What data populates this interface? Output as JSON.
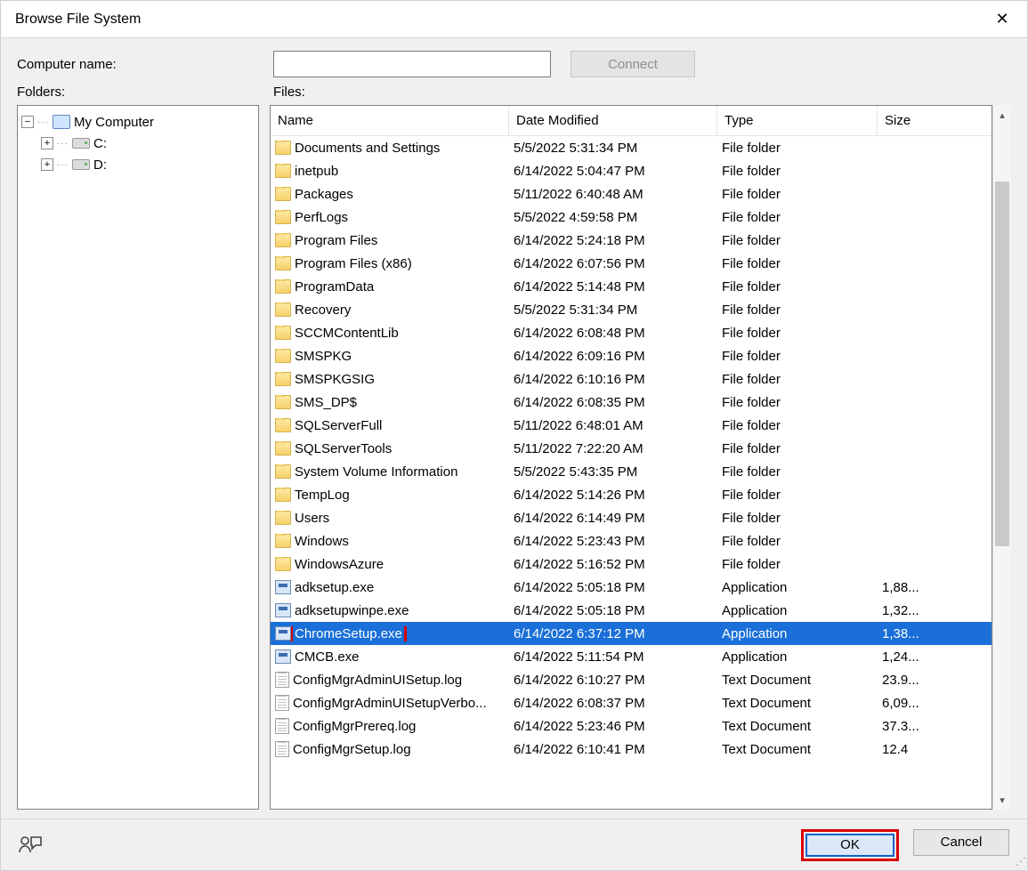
{
  "window": {
    "title": "Browse File System"
  },
  "labels": {
    "computer_name": "Computer name:",
    "folders": "Folders:",
    "files": "Files:"
  },
  "buttons": {
    "connect": "Connect",
    "ok": "OK",
    "cancel": "Cancel"
  },
  "inputs": {
    "computer_name_value": ""
  },
  "tree": {
    "root": "My Computer",
    "drives": [
      "C:",
      "D:"
    ]
  },
  "columns": {
    "name": "Name",
    "date": "Date Modified",
    "type": "Type",
    "size": "Size"
  },
  "types": {
    "folder": "File folder",
    "app": "Application",
    "txt": "Text Document"
  },
  "files": [
    {
      "icon": "folder",
      "name": "Documents and Settings",
      "date": "5/5/2022 5:31:34 PM",
      "type": "folder",
      "size": ""
    },
    {
      "icon": "folder",
      "name": "inetpub",
      "date": "6/14/2022 5:04:47 PM",
      "type": "folder",
      "size": ""
    },
    {
      "icon": "folder",
      "name": "Packages",
      "date": "5/11/2022 6:40:48 AM",
      "type": "folder",
      "size": ""
    },
    {
      "icon": "folder",
      "name": "PerfLogs",
      "date": "5/5/2022 4:59:58 PM",
      "type": "folder",
      "size": ""
    },
    {
      "icon": "folder",
      "name": "Program Files",
      "date": "6/14/2022 5:24:18 PM",
      "type": "folder",
      "size": ""
    },
    {
      "icon": "folder",
      "name": "Program Files (x86)",
      "date": "6/14/2022 6:07:56 PM",
      "type": "folder",
      "size": ""
    },
    {
      "icon": "folder",
      "name": "ProgramData",
      "date": "6/14/2022 5:14:48 PM",
      "type": "folder",
      "size": ""
    },
    {
      "icon": "folder",
      "name": "Recovery",
      "date": "5/5/2022 5:31:34 PM",
      "type": "folder",
      "size": ""
    },
    {
      "icon": "folder",
      "name": "SCCMContentLib",
      "date": "6/14/2022 6:08:48 PM",
      "type": "folder",
      "size": ""
    },
    {
      "icon": "folder",
      "name": "SMSPKG",
      "date": "6/14/2022 6:09:16 PM",
      "type": "folder",
      "size": ""
    },
    {
      "icon": "folder",
      "name": "SMSPKGSIG",
      "date": "6/14/2022 6:10:16 PM",
      "type": "folder",
      "size": ""
    },
    {
      "icon": "folder",
      "name": "SMS_DP$",
      "date": "6/14/2022 6:08:35 PM",
      "type": "folder",
      "size": ""
    },
    {
      "icon": "folder",
      "name": "SQLServerFull",
      "date": "5/11/2022 6:48:01 AM",
      "type": "folder",
      "size": ""
    },
    {
      "icon": "folder",
      "name": "SQLServerTools",
      "date": "5/11/2022 7:22:20 AM",
      "type": "folder",
      "size": ""
    },
    {
      "icon": "folder",
      "name": "System Volume Information",
      "date": "5/5/2022 5:43:35 PM",
      "type": "folder",
      "size": ""
    },
    {
      "icon": "folder",
      "name": "TempLog",
      "date": "6/14/2022 5:14:26 PM",
      "type": "folder",
      "size": ""
    },
    {
      "icon": "folder",
      "name": "Users",
      "date": "6/14/2022 6:14:49 PM",
      "type": "folder",
      "size": ""
    },
    {
      "icon": "folder",
      "name": "Windows",
      "date": "6/14/2022 5:23:43 PM",
      "type": "folder",
      "size": ""
    },
    {
      "icon": "folder",
      "name": "WindowsAzure",
      "date": "6/14/2022 5:16:52 PM",
      "type": "folder",
      "size": ""
    },
    {
      "icon": "exe",
      "name": "adksetup.exe",
      "date": "6/14/2022 5:05:18 PM",
      "type": "app",
      "size": "1,88..."
    },
    {
      "icon": "exe",
      "name": "adksetupwinpe.exe",
      "date": "6/14/2022 5:05:18 PM",
      "type": "app",
      "size": "1,32..."
    },
    {
      "icon": "exe",
      "name": "ChromeSetup.exe",
      "date": "6/14/2022 6:37:12 PM",
      "type": "app",
      "size": "1,38...",
      "selected": true,
      "highlight": true
    },
    {
      "icon": "exe",
      "name": "CMCB.exe",
      "date": "6/14/2022 5:11:54 PM",
      "type": "app",
      "size": "1,24..."
    },
    {
      "icon": "doc",
      "name": "ConfigMgrAdminUISetup.log",
      "date": "6/14/2022 6:10:27 PM",
      "type": "txt",
      "size": "23.9..."
    },
    {
      "icon": "doc",
      "name": "ConfigMgrAdminUISetupVerbo...",
      "date": "6/14/2022 6:08:37 PM",
      "type": "txt",
      "size": "6,09..."
    },
    {
      "icon": "doc",
      "name": "ConfigMgrPrereq.log",
      "date": "6/14/2022 5:23:46 PM",
      "type": "txt",
      "size": "37.3..."
    },
    {
      "icon": "doc",
      "name": "ConfigMgrSetup.log",
      "date": "6/14/2022 6:10:41 PM",
      "type": "txt",
      "size": "12.4"
    }
  ]
}
